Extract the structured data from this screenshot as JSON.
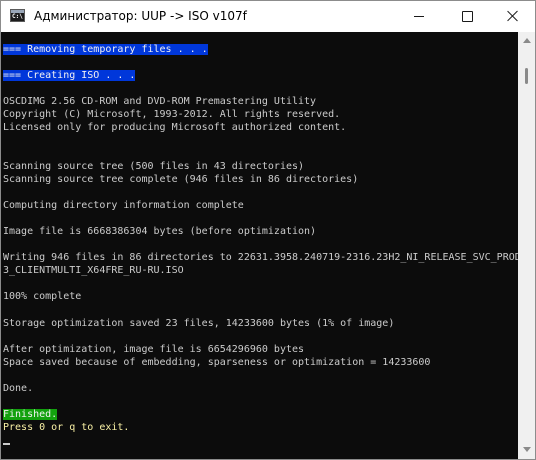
{
  "window": {
    "title": "Администратор:  UUP -> ISO v107f",
    "icon": "cmd-console-icon",
    "icon_text": "C:\\"
  },
  "console": {
    "lines": [
      {
        "text": "=== Removing temporary files . . .",
        "style": "blue"
      },
      {
        "text": "=== Creating ISO . . .",
        "style": "blue"
      },
      {
        "text": "OSCDIMG 2.56 CD-ROM and DVD-ROM Premastering Utility",
        "style": "normal"
      },
      {
        "text": "Copyright (C) Microsoft, 1993-2012. All rights reserved.",
        "style": "normal"
      },
      {
        "text": "Licensed only for producing Microsoft authorized content.",
        "style": "normal"
      },
      {
        "text": "Scanning source tree (500 files in 43 directories)",
        "style": "normal"
      },
      {
        "text": "Scanning source tree complete (946 files in 86 directories)",
        "style": "normal"
      },
      {
        "text": "Computing directory information complete",
        "style": "normal"
      },
      {
        "text": "Image file is 6668386304 bytes (before optimization)",
        "style": "normal"
      },
      {
        "text": "Writing 946 files in 86 directories to 22631.3958.240719-2316.23H2_NI_RELEASE_SVC_PROD",
        "style": "normal"
      },
      {
        "text": "3_CLIENTMULTI_X64FRE_RU-RU.ISO",
        "style": "normal"
      },
      {
        "text": "100% complete",
        "style": "normal"
      },
      {
        "text": "Storage optimization saved 23 files, 14233600 bytes (1% of image)",
        "style": "normal"
      },
      {
        "text": "After optimization, image file is 6654296960 bytes",
        "style": "normal"
      },
      {
        "text": "Space saved because of embedding, sparseness or optimization = 14233600",
        "style": "normal"
      },
      {
        "text": "Done.",
        "style": "normal"
      },
      {
        "text": "Finished.",
        "style": "green"
      },
      {
        "text": "Press 0 or q to exit.",
        "style": "yellow"
      }
    ]
  },
  "colors": {
    "console_bg": "#0c0c0c",
    "console_fg": "#cccccc",
    "highlight_blue": "#0037da",
    "highlight_green": "#13a10e",
    "prompt_yellow": "#f9f1a5"
  }
}
